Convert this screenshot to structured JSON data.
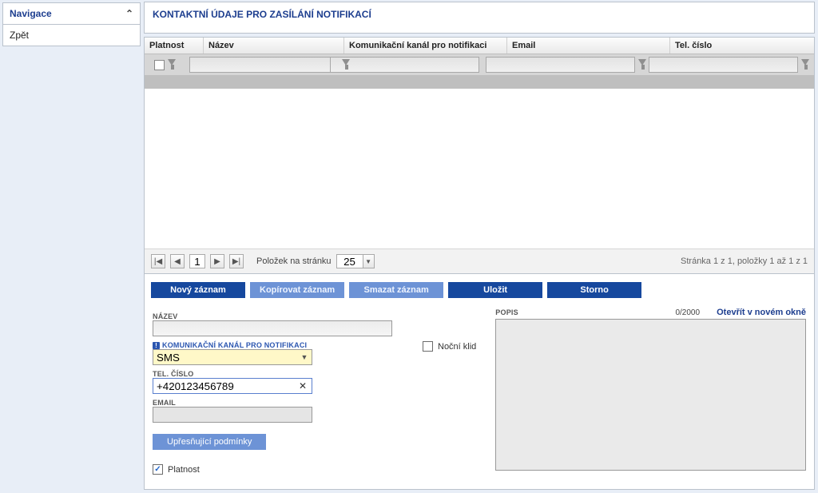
{
  "sidebar": {
    "title": "Navigace",
    "items": [
      "Zpět"
    ]
  },
  "panel": {
    "title": "KONTAKTNÍ ÚDAJE PRO ZASÍLÁNÍ NOTIFIKACÍ"
  },
  "grid": {
    "columns": {
      "platnost": "Platnost",
      "nazev": "Název",
      "komkanal": "Komunikační kanál pro notifikaci",
      "email": "Email",
      "tel": "Tel. číslo"
    }
  },
  "pager": {
    "first": "|◀",
    "prev": "◀",
    "next": "▶",
    "last": "▶|",
    "page": "1",
    "page_size_label": "Položek na stránku",
    "page_size": "25",
    "info": "Stránka 1 z 1, položky 1 až 1 z 1"
  },
  "actions": {
    "novy": "Nový záznam",
    "kopirovat": "Kopírovat záznam",
    "smazat": "Smazat záznam",
    "ulozit": "Uložit",
    "storno": "Storno"
  },
  "form": {
    "nazev_label": "NÁZEV",
    "nazev_value": "",
    "komkanal_label": "KOMUNIKAČNÍ KANÁL PRO NOTIFIKACI",
    "komkanal_value": "SMS",
    "tel_label": "TEL. ČÍSLO",
    "tel_value": "+420123456789",
    "email_label": "EMAIL",
    "email_value": "",
    "upresnujici": "Upřesňující podmínky",
    "platnost_label": "Platnost",
    "platnost_checked": true,
    "nocni_label": "Noční klid",
    "nocni_checked": false,
    "popis_label": "POPIS",
    "popis_counter": "0/2000",
    "popis_open": "Otevřít v novém okně",
    "popis_value": ""
  }
}
